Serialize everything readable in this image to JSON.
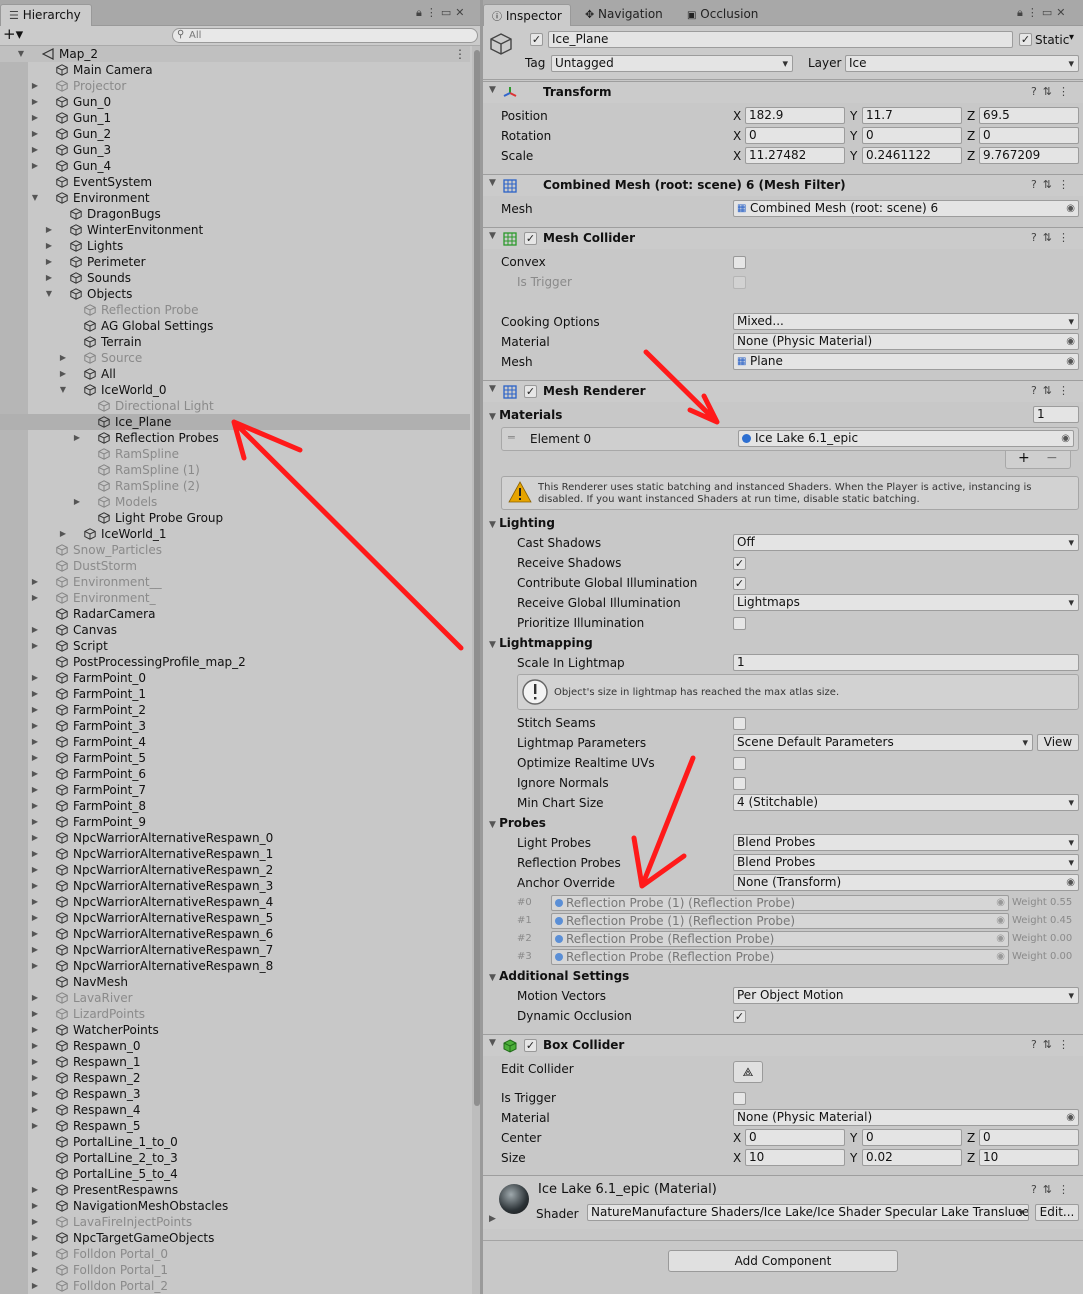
{
  "hierarchy": {
    "tab_label": "Hierarchy",
    "search_placeholder": "All",
    "rows": [
      {
        "label": "Map_2",
        "depth": 0,
        "fold": "open",
        "scene": true
      },
      {
        "label": "Main Camera",
        "depth": 1,
        "fold": "none"
      },
      {
        "label": "Projector",
        "depth": 1,
        "fold": "closed",
        "disabled": true
      },
      {
        "label": "Gun_0",
        "depth": 1,
        "fold": "closed"
      },
      {
        "label": "Gun_1",
        "depth": 1,
        "fold": "closed"
      },
      {
        "label": "Gun_2",
        "depth": 1,
        "fold": "closed"
      },
      {
        "label": "Gun_3",
        "depth": 1,
        "fold": "closed"
      },
      {
        "label": "Gun_4",
        "depth": 1,
        "fold": "closed"
      },
      {
        "label": "EventSystem",
        "depth": 1,
        "fold": "none"
      },
      {
        "label": "Environment",
        "depth": 1,
        "fold": "open"
      },
      {
        "label": "DragonBugs",
        "depth": 2,
        "fold": "none"
      },
      {
        "label": "WinterEnvitonment",
        "depth": 2,
        "fold": "closed"
      },
      {
        "label": "Lights",
        "depth": 2,
        "fold": "closed"
      },
      {
        "label": "Perimeter",
        "depth": 2,
        "fold": "closed"
      },
      {
        "label": "Sounds",
        "depth": 2,
        "fold": "closed"
      },
      {
        "label": "Objects",
        "depth": 2,
        "fold": "open"
      },
      {
        "label": "Reflection Probe",
        "depth": 3,
        "fold": "none",
        "disabled": true
      },
      {
        "label": "AG Global Settings",
        "depth": 3,
        "fold": "none"
      },
      {
        "label": "Terrain",
        "depth": 3,
        "fold": "none"
      },
      {
        "label": "Source",
        "depth": 3,
        "fold": "closed",
        "disabled": true
      },
      {
        "label": "All",
        "depth": 3,
        "fold": "closed"
      },
      {
        "label": "IceWorld_0",
        "depth": 3,
        "fold": "open"
      },
      {
        "label": "Directional Light",
        "depth": 4,
        "fold": "none",
        "disabled": true
      },
      {
        "label": "Ice_Plane",
        "depth": 4,
        "fold": "none",
        "selected": true
      },
      {
        "label": "Reflection Probes",
        "depth": 4,
        "fold": "closed"
      },
      {
        "label": "RamSpline",
        "depth": 4,
        "fold": "none",
        "disabled": true
      },
      {
        "label": "RamSpline (1)",
        "depth": 4,
        "fold": "none",
        "disabled": true
      },
      {
        "label": "RamSpline (2)",
        "depth": 4,
        "fold": "none",
        "disabled": true
      },
      {
        "label": "Models",
        "depth": 4,
        "fold": "closed",
        "disabled": true
      },
      {
        "label": "Light Probe Group",
        "depth": 4,
        "fold": "none"
      },
      {
        "label": "IceWorld_1",
        "depth": 3,
        "fold": "closed"
      },
      {
        "label": "Snow_Particles",
        "depth": 1,
        "fold": "none",
        "disabled": true
      },
      {
        "label": "DustStorm",
        "depth": 1,
        "fold": "none",
        "disabled": true
      },
      {
        "label": "Environment__",
        "depth": 1,
        "fold": "closed",
        "disabled": true
      },
      {
        "label": "Environment_",
        "depth": 1,
        "fold": "closed",
        "disabled": true
      },
      {
        "label": "RadarCamera",
        "depth": 1,
        "fold": "none"
      },
      {
        "label": "Canvas",
        "depth": 1,
        "fold": "closed"
      },
      {
        "label": "Script",
        "depth": 1,
        "fold": "closed"
      },
      {
        "label": "PostProcessingProfile_map_2",
        "depth": 1,
        "fold": "none"
      },
      {
        "label": "FarmPoint_0",
        "depth": 1,
        "fold": "closed"
      },
      {
        "label": "FarmPoint_1",
        "depth": 1,
        "fold": "closed"
      },
      {
        "label": "FarmPoint_2",
        "depth": 1,
        "fold": "closed"
      },
      {
        "label": "FarmPoint_3",
        "depth": 1,
        "fold": "closed"
      },
      {
        "label": "FarmPoint_4",
        "depth": 1,
        "fold": "closed"
      },
      {
        "label": "FarmPoint_5",
        "depth": 1,
        "fold": "closed"
      },
      {
        "label": "FarmPoint_6",
        "depth": 1,
        "fold": "closed"
      },
      {
        "label": "FarmPoint_7",
        "depth": 1,
        "fold": "closed"
      },
      {
        "label": "FarmPoint_8",
        "depth": 1,
        "fold": "closed"
      },
      {
        "label": "FarmPoint_9",
        "depth": 1,
        "fold": "closed"
      },
      {
        "label": "NpcWarriorAlternativeRespawn_0",
        "depth": 1,
        "fold": "closed"
      },
      {
        "label": "NpcWarriorAlternativeRespawn_1",
        "depth": 1,
        "fold": "closed"
      },
      {
        "label": "NpcWarriorAlternativeRespawn_2",
        "depth": 1,
        "fold": "closed"
      },
      {
        "label": "NpcWarriorAlternativeRespawn_3",
        "depth": 1,
        "fold": "closed"
      },
      {
        "label": "NpcWarriorAlternativeRespawn_4",
        "depth": 1,
        "fold": "closed"
      },
      {
        "label": "NpcWarriorAlternativeRespawn_5",
        "depth": 1,
        "fold": "closed"
      },
      {
        "label": "NpcWarriorAlternativeRespawn_6",
        "depth": 1,
        "fold": "closed"
      },
      {
        "label": "NpcWarriorAlternativeRespawn_7",
        "depth": 1,
        "fold": "closed"
      },
      {
        "label": "NpcWarriorAlternativeRespawn_8",
        "depth": 1,
        "fold": "closed"
      },
      {
        "label": "NavMesh",
        "depth": 1,
        "fold": "none"
      },
      {
        "label": "LavaRiver",
        "depth": 1,
        "fold": "closed",
        "disabled": true
      },
      {
        "label": "LizardPoints",
        "depth": 1,
        "fold": "closed",
        "disabled": true
      },
      {
        "label": "WatcherPoints",
        "depth": 1,
        "fold": "closed"
      },
      {
        "label": "Respawn_0",
        "depth": 1,
        "fold": "closed"
      },
      {
        "label": "Respawn_1",
        "depth": 1,
        "fold": "closed"
      },
      {
        "label": "Respawn_2",
        "depth": 1,
        "fold": "closed"
      },
      {
        "label": "Respawn_3",
        "depth": 1,
        "fold": "closed"
      },
      {
        "label": "Respawn_4",
        "depth": 1,
        "fold": "closed"
      },
      {
        "label": "Respawn_5",
        "depth": 1,
        "fold": "closed"
      },
      {
        "label": "PortalLine_1_to_0",
        "depth": 1,
        "fold": "none"
      },
      {
        "label": "PortalLine_2_to_3",
        "depth": 1,
        "fold": "none"
      },
      {
        "label": "PortalLine_5_to_4",
        "depth": 1,
        "fold": "none"
      },
      {
        "label": "PresentRespawns",
        "depth": 1,
        "fold": "closed"
      },
      {
        "label": "NavigationMeshObstacles",
        "depth": 1,
        "fold": "closed"
      },
      {
        "label": "LavaFireInjectPoints",
        "depth": 1,
        "fold": "closed",
        "disabled": true
      },
      {
        "label": "NpcTargetGameObjects",
        "depth": 1,
        "fold": "closed"
      },
      {
        "label": "Folldon Portal_0",
        "depth": 1,
        "fold": "closed",
        "disabled": true
      },
      {
        "label": "Folldon Portal_1",
        "depth": 1,
        "fold": "closed",
        "disabled": true
      },
      {
        "label": "Folldon Portal_2",
        "depth": 1,
        "fold": "closed",
        "disabled": true
      }
    ]
  },
  "inspector": {
    "tabs": {
      "inspector": "Inspector",
      "navigation": "Navigation",
      "occlusion": "Occlusion"
    },
    "object": {
      "name": "Ice_Plane",
      "static_label": "Static",
      "tag_label": "Tag",
      "tag_value": "Untagged",
      "layer_label": "Layer",
      "layer_value": "Ice"
    },
    "axes": {
      "x": "X",
      "y": "Y",
      "z": "Z"
    },
    "transform": {
      "title": "Transform",
      "position_label": "Position",
      "position": {
        "x": "182.9",
        "y": "11.7",
        "z": "69.5"
      },
      "rotation_label": "Rotation",
      "rotation": {
        "x": "0",
        "y": "0",
        "z": "0"
      },
      "scale_label": "Scale",
      "scale": {
        "x": "11.27482",
        "y": "0.2461122",
        "z": "9.767209"
      }
    },
    "mesh_filter": {
      "title": "Combined Mesh (root: scene) 6 (Mesh Filter)",
      "mesh_label": "Mesh",
      "mesh_value": "Combined Mesh (root: scene) 6"
    },
    "mesh_collider": {
      "title": "Mesh Collider",
      "convex_label": "Convex",
      "is_trigger_label": "Is Trigger",
      "cooking_label": "Cooking Options",
      "cooking_value": "Mixed...",
      "material_label": "Material",
      "material_value": "None (Physic Material)",
      "mesh_label": "Mesh",
      "mesh_value": "Plane"
    },
    "mesh_renderer": {
      "title": "Mesh Renderer",
      "materials_label": "Materials",
      "materials_count": "1",
      "element_label": "Element 0",
      "element_value": "Ice Lake 6.1_epic",
      "plus": "+",
      "minus": "−",
      "warning": "This Renderer uses static batching and instanced Shaders. When the Player is active, instancing is disabled. If you want instanced Shaders at run time, disable static batching.",
      "lighting_label": "Lighting",
      "cast_shadows_label": "Cast Shadows",
      "cast_shadows_value": "Off",
      "receive_shadows_label": "Receive Shadows",
      "contribute_gi_label": "Contribute Global Illumination",
      "receive_gi_label": "Receive Global Illumination",
      "receive_gi_value": "Lightmaps",
      "prioritize_label": "Prioritize Illumination",
      "lightmapping_label": "Lightmapping",
      "scale_lightmap_label": "Scale In Lightmap",
      "scale_lightmap_value": "1",
      "lightmap_info": "Object's size in lightmap has reached the max atlas size.",
      "stitch_label": "Stitch Seams",
      "lightmap_params_label": "Lightmap Parameters",
      "lightmap_params_value": "Scene Default Parameters",
      "view_button": "View",
      "optimize_uv_label": "Optimize Realtime UVs",
      "ignore_normals_label": "Ignore Normals",
      "min_chart_label": "Min Chart Size",
      "min_chart_value": "4 (Stitchable)",
      "probes_label": "Probes",
      "light_probes_label": "Light Probes",
      "light_probes_value": "Blend Probes",
      "reflection_probes_label": "Reflection Probes",
      "reflection_probes_value": "Blend Probes",
      "anchor_label": "Anchor Override",
      "anchor_value": "None (Transform)",
      "probe_list": [
        {
          "idx": "#0",
          "name": "Reflection Probe (1) (Reflection Probe)",
          "weight": "Weight 0.55"
        },
        {
          "idx": "#1",
          "name": "Reflection Probe (1) (Reflection Probe)",
          "weight": "Weight 0.45"
        },
        {
          "idx": "#2",
          "name": "Reflection Probe (Reflection Probe)",
          "weight": "Weight 0.00"
        },
        {
          "idx": "#3",
          "name": "Reflection Probe (Reflection Probe)",
          "weight": "Weight 0.00"
        }
      ],
      "additional_label": "Additional Settings",
      "motion_vectors_label": "Motion Vectors",
      "motion_vectors_value": "Per Object Motion",
      "dynamic_occlusion_label": "Dynamic Occlusion"
    },
    "box_collider": {
      "title": "Box Collider",
      "edit_label": "Edit Collider",
      "is_trigger_label": "Is Trigger",
      "material_label": "Material",
      "material_value": "None (Physic Material)",
      "center_label": "Center",
      "center": {
        "x": "0",
        "y": "0",
        "z": "0"
      },
      "size_label": "Size",
      "size": {
        "x": "10",
        "y": "0.02",
        "z": "10"
      }
    },
    "material": {
      "title": "Ice Lake 6.1_epic (Material)",
      "shader_label": "Shader",
      "shader_value": "NatureManufacture Shaders/Ice Lake/Ice Shader Specular Lake Translucen",
      "edit_button": "Edit..."
    },
    "add_component": "Add Component"
  },
  "colors": {
    "annotation_arrow": "#ff1a1a",
    "selection": "#b0b0b0",
    "panel": "#c8c8c8",
    "field": "#e4e4e4"
  }
}
